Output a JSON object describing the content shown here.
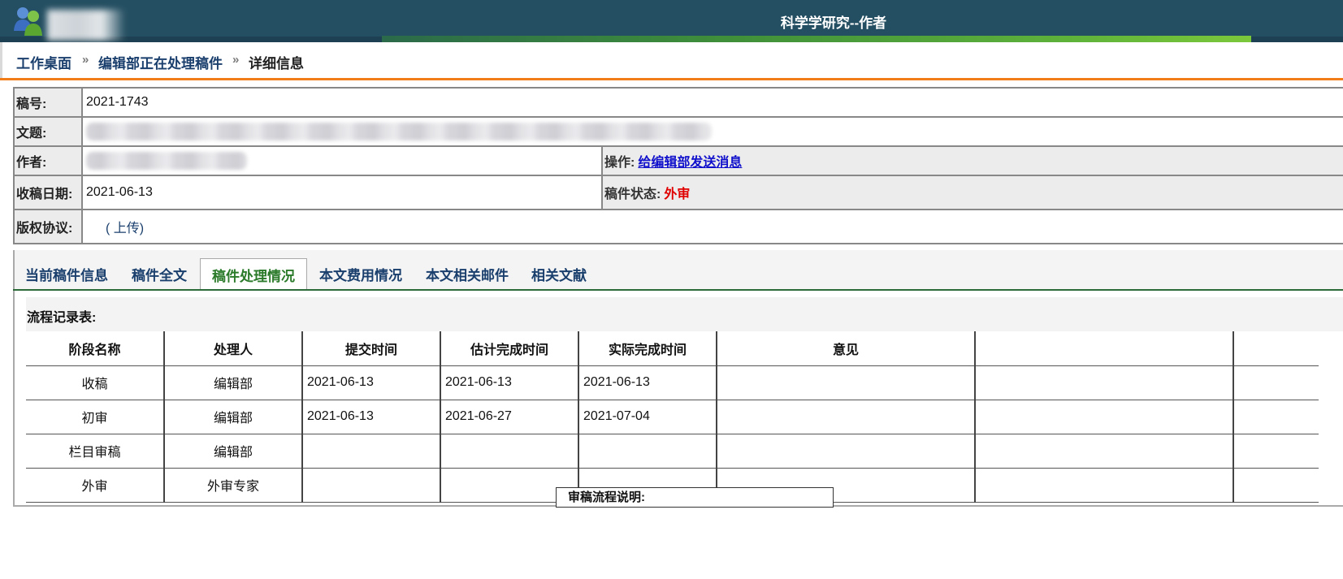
{
  "header": {
    "site_title": "科学学研究--作者"
  },
  "breadcrumb": {
    "items": [
      "工作桌面",
      "编辑部正在处理稿件",
      "详细信息"
    ],
    "separator": "»"
  },
  "info": {
    "manuscript_no_label": "稿号:",
    "manuscript_no": "2021-1743",
    "title_label": "文题:",
    "author_label": "作者:",
    "operation_label": "操作:",
    "operation_link": "给编辑部发送消息",
    "received_label": "收稿日期:",
    "received_date": "2021-06-13",
    "status_label": "稿件状态:",
    "status_value": "外审",
    "copyright_label": "版权协议:",
    "upload_link": "( 上传)"
  },
  "tabs": [
    {
      "label": "当前稿件信息"
    },
    {
      "label": "稿件全文"
    },
    {
      "label": "稿件处理情况"
    },
    {
      "label": "本文费用情况"
    },
    {
      "label": "本文相关邮件"
    },
    {
      "label": "相关文献"
    }
  ],
  "flow": {
    "title": "流程记录表:",
    "columns": [
      "阶段名称",
      "处理人",
      "提交时间",
      "估计完成时间",
      "实际完成时间",
      "意见",
      "",
      ""
    ],
    "rows": [
      [
        "收稿",
        "编辑部",
        "2021-06-13",
        "2021-06-13",
        "2021-06-13",
        "",
        "",
        ""
      ],
      [
        "初审",
        "编辑部",
        "2021-06-13",
        "2021-06-27",
        "2021-07-04",
        "",
        "",
        ""
      ],
      [
        "栏目审稿",
        "编辑部",
        "",
        "",
        "",
        "",
        "",
        ""
      ],
      [
        "外审",
        "外审专家",
        "",
        "",
        "",
        "",
        "",
        ""
      ]
    ]
  },
  "popup": {
    "label": "审稿流程说明:"
  },
  "colors": {
    "header_bg": "#244f62",
    "breadcrumb_line": "#f07d1a",
    "link_blue": "#1010cc",
    "status_red": "#e00000",
    "active_tab_green": "#2a7a2a"
  }
}
